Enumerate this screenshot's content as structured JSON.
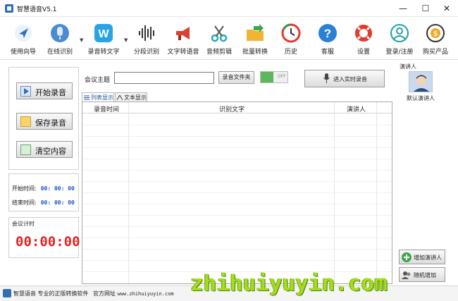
{
  "window": {
    "title": "智慧语音V5.1",
    "controls": [
      "minimize",
      "maximize",
      "close"
    ]
  },
  "toolbar": {
    "items": [
      {
        "label": "使用向导",
        "icon": "navigation-arrow-icon"
      },
      {
        "label": "在线识别",
        "icon": "microphone-icon",
        "has_dropdown": true
      },
      {
        "label": "录音转文字",
        "icon": "w-letter-icon",
        "has_dropdown": true
      },
      {
        "label": "分段识别",
        "icon": "waveform-icon"
      },
      {
        "label": "文字转语音",
        "icon": "megaphone-icon"
      },
      {
        "label": "音频剪辑",
        "icon": "scissors-icon"
      },
      {
        "label": "批量转换",
        "icon": "folder-arrow-icon"
      },
      {
        "label": "历史",
        "icon": "history-clock-icon"
      },
      {
        "label": "客服",
        "icon": "help-question-icon"
      },
      {
        "label": "设置",
        "icon": "lifebuoy-icon"
      },
      {
        "label": "登录/注册",
        "icon": "user-circle-icon"
      },
      {
        "label": "购买产品",
        "icon": "purchase-coin-icon"
      }
    ]
  },
  "left": {
    "start_record": "开始录音",
    "save_record": "保存录音",
    "clear_content": "清空内容",
    "start_time_label": "开始时间:",
    "start_time": "00: 00: 00",
    "end_time_label": "结束时间:",
    "end_time": "00: 00: 00",
    "meeting_timer_label": "会议计时",
    "meeting_timer": "00:00:00"
  },
  "center": {
    "topic_label": "会议主题",
    "topic_value": "",
    "record_folder_button": "录音文件夹",
    "toggle_state": "off",
    "toggle_off_label": "OFF",
    "realtime_button": "进入实时录音",
    "tabs": [
      {
        "label": "列表显示",
        "active": true
      },
      {
        "label": "文本显示",
        "active": false
      }
    ],
    "table": {
      "columns": [
        "录音时间",
        "识别文字",
        "演讲人"
      ],
      "rows": []
    }
  },
  "right": {
    "speaker_title": "演讲人",
    "default_speaker": "默认演讲人",
    "add_speaker": "增加演讲人",
    "random_add": "随机增加"
  },
  "status": {
    "brand": "智慧语音",
    "slogan": "专业的正版转换软件",
    "site_label": "官方网址",
    "site": "www.zhihuiyuyin.com",
    "watermark": "zhihuiyuyin.com"
  },
  "colors": {
    "timer_red": "#e0221f",
    "time_blue": "#1a55c8",
    "toggle_green": "#5cb85c",
    "watermark_green": "#a4dd1a"
  }
}
